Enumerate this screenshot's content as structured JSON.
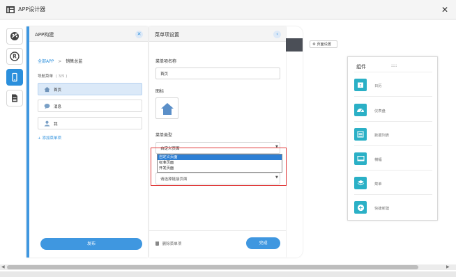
{
  "window": {
    "title": "APP设计器",
    "close_glyph": "✕"
  },
  "build_panel": {
    "title": "APP构建",
    "breadcrumb": {
      "root": "全部APP",
      "separator": ">",
      "current": "销售总监"
    },
    "nav_caption": "导航菜单",
    "nav_count": "( 3/5 )",
    "items": [
      {
        "label": "首页",
        "icon": "home-icon",
        "selected": true
      },
      {
        "label": "消息",
        "icon": "chat-icon",
        "selected": false
      },
      {
        "label": "我",
        "icon": "user-icon",
        "selected": false
      }
    ],
    "add_item": "+ 添加菜单项",
    "publish": "发布"
  },
  "menu_panel": {
    "title": "菜单项设置",
    "name_label": "菜单项名称",
    "name_value": "首页",
    "icon_label": "图标",
    "type_label": "菜单类型",
    "type_value": "自定义页面",
    "link_value": "请选择链接页面",
    "type_options": [
      {
        "label": "自定义页面",
        "selected": true
      },
      {
        "label": "标准页面",
        "selected": false
      },
      {
        "label": "开发页面",
        "selected": false
      }
    ],
    "delete": "删除菜单项",
    "done": "完成"
  },
  "canvas": {
    "page_settings": "页面设置"
  },
  "components": {
    "title": "组件",
    "drag_hint": "::::",
    "items": [
      {
        "label": "日历",
        "icon": "calendar-icon"
      },
      {
        "label": "仪表盘",
        "icon": "gauge-icon"
      },
      {
        "label": "数据列表",
        "icon": "list-icon"
      },
      {
        "label": "横幅",
        "icon": "banner-icon"
      },
      {
        "label": "菜单",
        "icon": "layers-icon"
      },
      {
        "label": "快捷新建",
        "icon": "plus-icon"
      }
    ]
  },
  "scrollbar": {
    "left": "◀",
    "right": "▶"
  },
  "colors": {
    "accent": "#3f97e0",
    "component": "#2bb0c6",
    "highlight_frame": "#e03838"
  }
}
